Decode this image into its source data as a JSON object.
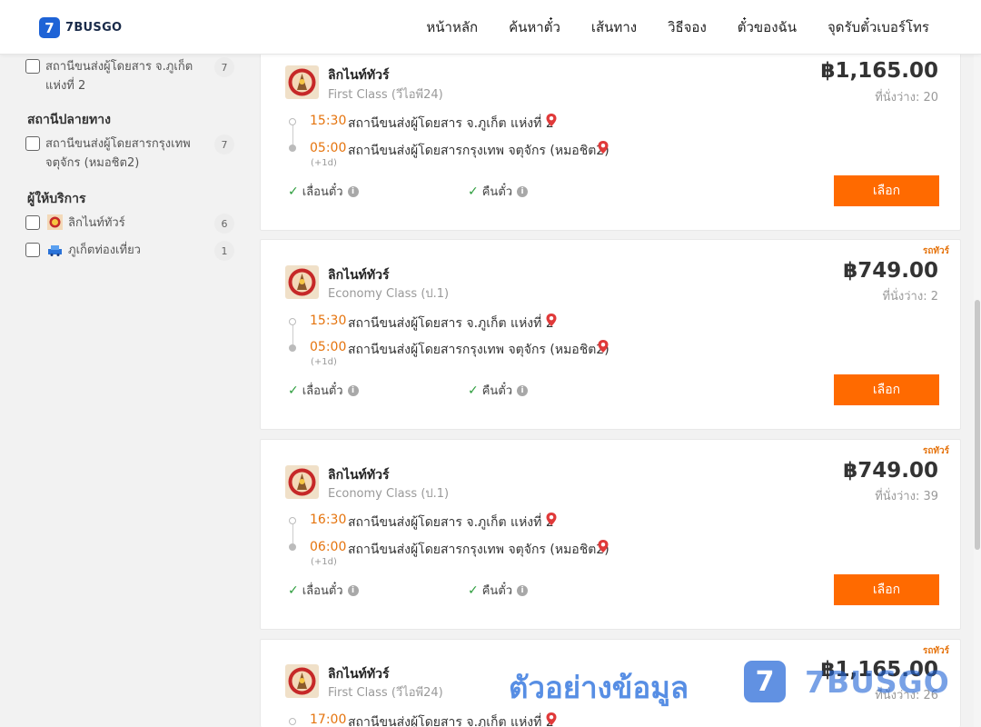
{
  "header": {
    "logo_mark": "7",
    "logo_text": "7BUSGO",
    "nav": [
      "หน้าหลัก",
      "ค้นหาตั๋ว",
      "เส้นทาง",
      "วิธีจอง",
      "ตั๋วของฉัน",
      "จุดรับตั๋วเบอร์โทร"
    ]
  },
  "sidebar": {
    "origin_item": {
      "label": "สถานีขนส่งผู้โดยสาร จ.ภูเก็ต แห่งที่ 2",
      "count": "7"
    },
    "destination_heading": "สถานีปลายทาง",
    "destination_item": {
      "label": "สถานีขนส่งผู้โดยสารกรุงเทพ จตุจักร (หมอชิต2)",
      "count": "7"
    },
    "operator_heading": "ผู้ให้บริการ",
    "operators": [
      {
        "label": "ลิกไนท์ทัวร์",
        "count": "6",
        "icon": "lignite-tour-logo"
      },
      {
        "label": "ภูเก็ตท่องเที่ยว",
        "count": "1",
        "icon": "phuket-travel-logo"
      }
    ]
  },
  "cards": [
    {
      "tag": "",
      "operator": "ลิกไนท์ทัวร์",
      "class": "First Class (วีไอพี24)",
      "price": "฿1,165.00",
      "seats": "ที่นั่งว่าง: 20",
      "dep_time": "15:30",
      "dep_station": "สถานีขนส่งผู้โดยสาร จ.ภูเก็ต แห่งที่ 2",
      "arr_time": "05:00",
      "arr_station": "สถานีขนส่งผู้โดยสารกรุงเทพ จตุจักร (หมอชิต2)",
      "plus_day": "(+1d)",
      "feature_1": "เลื่อนตั๋ว",
      "feature_2": "คืนตั๋ว",
      "button": "เลือก"
    },
    {
      "tag": "รถทัวร์",
      "operator": "ลิกไนท์ทัวร์",
      "class": "Economy Class (ป.1)",
      "price": "฿749.00",
      "seats": "ที่นั่งว่าง: 2",
      "dep_time": "15:30",
      "dep_station": "สถานีขนส่งผู้โดยสาร จ.ภูเก็ต แห่งที่ 2",
      "arr_time": "05:00",
      "arr_station": "สถานีขนส่งผู้โดยสารกรุงเทพ จตุจักร (หมอชิต2)",
      "plus_day": "(+1d)",
      "feature_1": "เลื่อนตั๋ว",
      "feature_2": "คืนตั๋ว",
      "button": "เลือก"
    },
    {
      "tag": "รถทัวร์",
      "operator": "ลิกไนท์ทัวร์",
      "class": "Economy Class (ป.1)",
      "price": "฿749.00",
      "seats": "ที่นั่งว่าง: 39",
      "dep_time": "16:30",
      "dep_station": "สถานีขนส่งผู้โดยสาร จ.ภูเก็ต แห่งที่ 2",
      "arr_time": "06:00",
      "arr_station": "สถานีขนส่งผู้โดยสารกรุงเทพ จตุจักร (หมอชิต2)",
      "plus_day": "(+1d)",
      "feature_1": "เลื่อนตั๋ว",
      "feature_2": "คืนตั๋ว",
      "button": "เลือก"
    },
    {
      "tag": "รถทัวร์",
      "operator": "ลิกไนท์ทัวร์",
      "class": "First Class (วีไอพี24)",
      "price": "฿1,165.00",
      "seats": "ที่นั่งว่าง: 26",
      "dep_time": "17:00",
      "dep_station": "สถานีขนส่งผู้โดยสาร จ.ภูเก็ต แห่งที่ 2"
    }
  ],
  "watermark": {
    "text": "ตัวอย่างข้อมูล",
    "mark": "7",
    "brand": "7BUSGO"
  },
  "colors": {
    "accent_orange": "#ff6a00",
    "time_orange": "#e5740e",
    "check_green": "#2e9e3e",
    "pin_red": "#e03a3a",
    "brand_blue": "#1e63d6"
  }
}
